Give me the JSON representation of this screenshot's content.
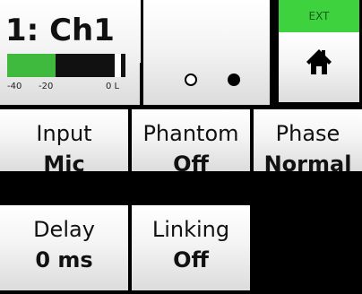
{
  "header": {
    "channel_title": "1: Ch1",
    "ext_label": "EXT",
    "meter": {
      "ticks": [
        "-40",
        "-20",
        "0 L"
      ],
      "level_fraction": 0.41,
      "colors": {
        "fill": "#3fba3f",
        "background": "#111111",
        "peak": "#ffffff"
      }
    }
  },
  "buttons": [
    {
      "label": "Input",
      "value": "Mic"
    },
    {
      "label": "Phantom",
      "value": "Off"
    },
    {
      "label": "Phase",
      "value": "Normal"
    },
    {
      "label": "Delay",
      "value": "0 ms"
    },
    {
      "label": "Linking",
      "value": "Off"
    }
  ],
  "icons": {
    "home": "home-icon"
  },
  "colors": {
    "ext_badge": "#3fd23f",
    "page_background": "#000000"
  }
}
